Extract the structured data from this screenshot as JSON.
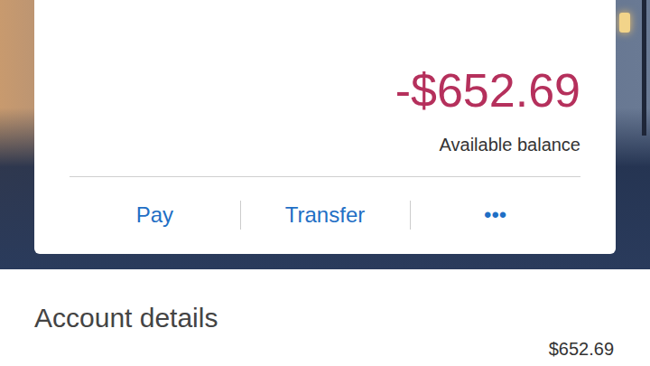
{
  "account": {
    "balance": "-$652.69",
    "balance_label": "Available balance",
    "actions": [
      {
        "label": "Pay"
      },
      {
        "label": "Transfer"
      },
      {
        "label": "•••"
      }
    ]
  },
  "details": {
    "title": "Account details",
    "rows": [
      {
        "value": "$652.69"
      }
    ]
  }
}
